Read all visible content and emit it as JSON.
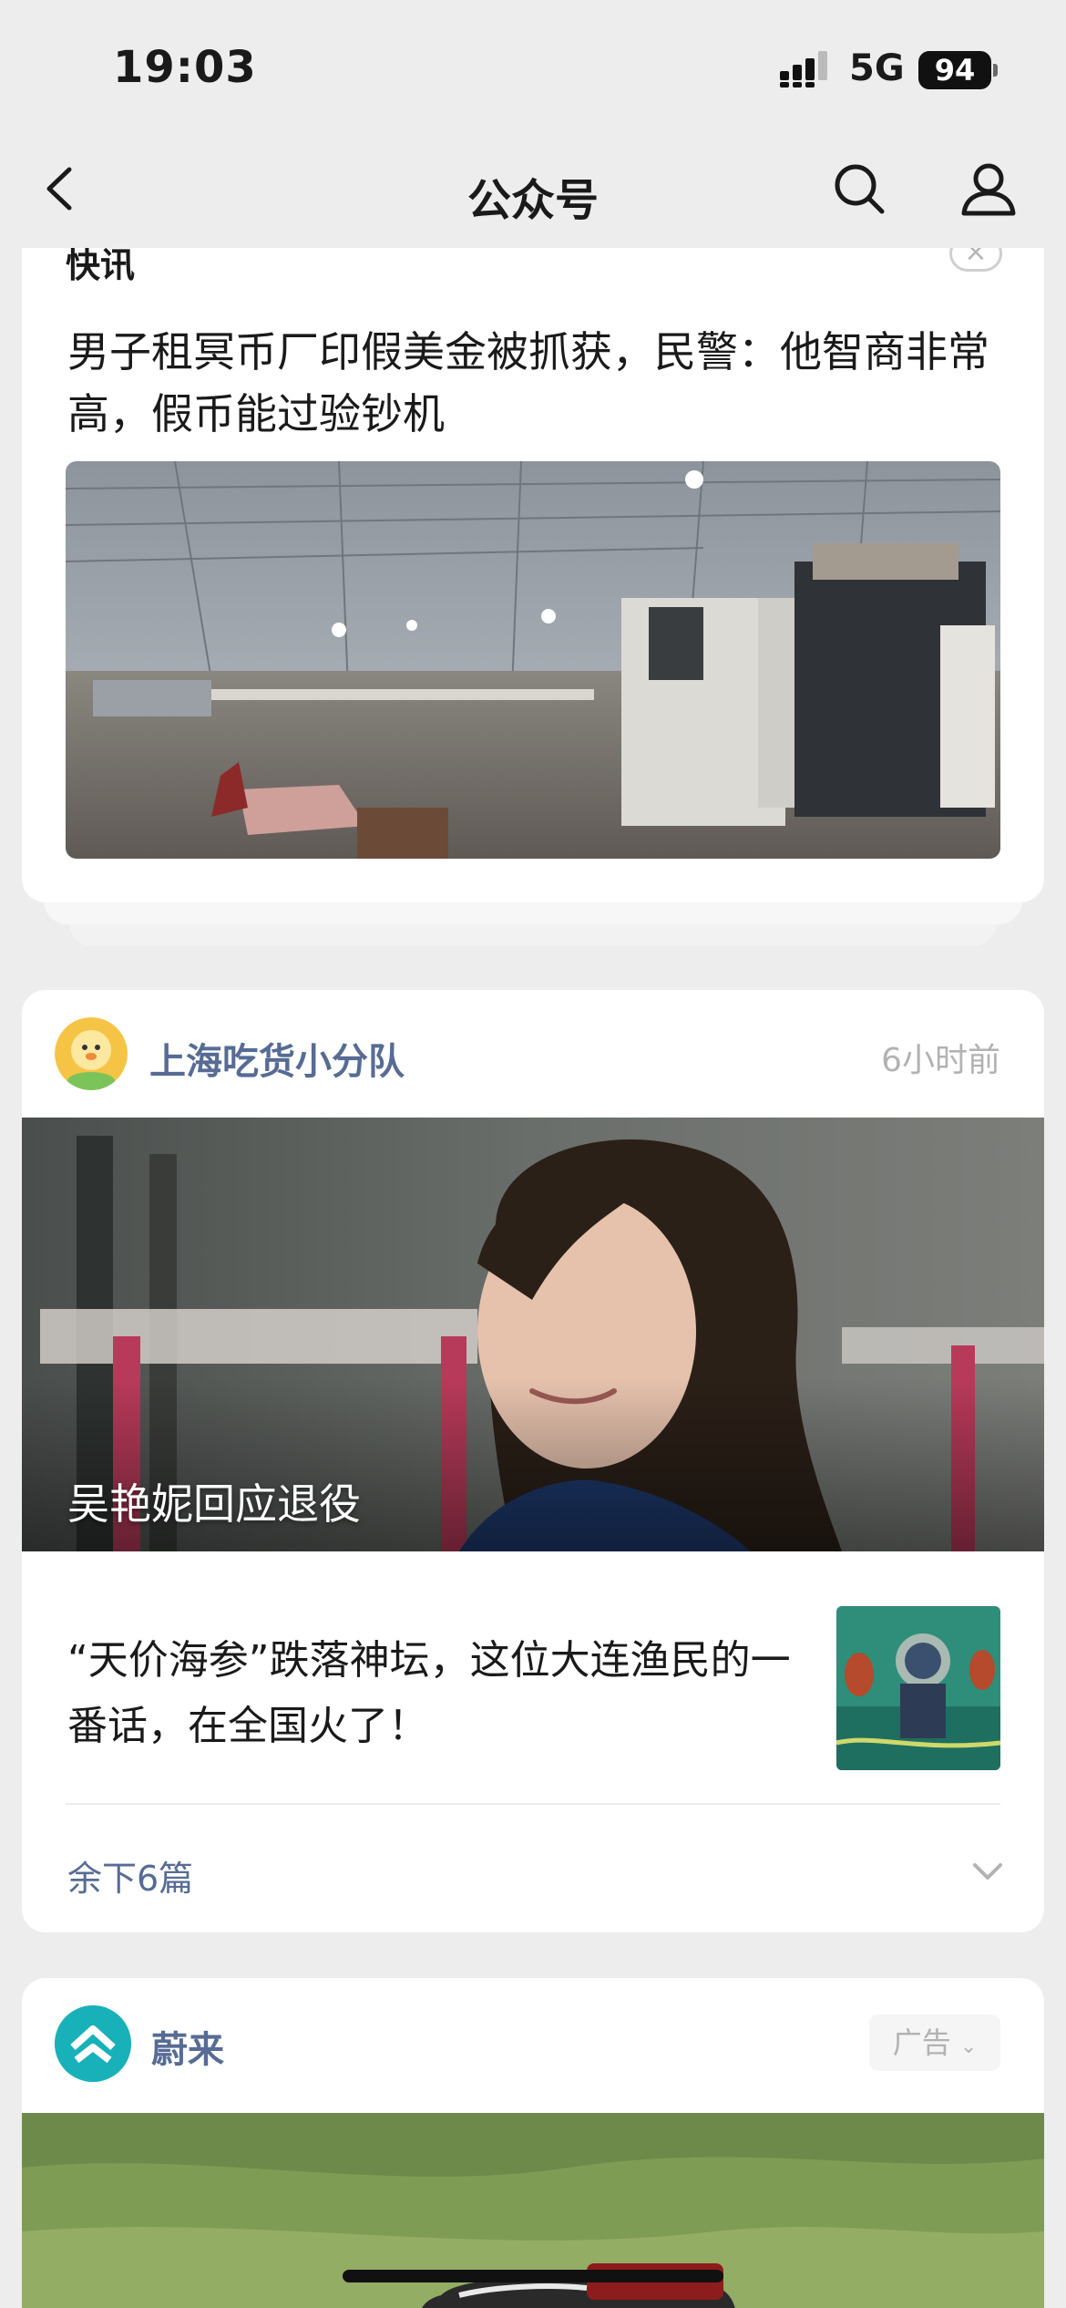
{
  "status_bar": {
    "time": "19:03",
    "network": "5G",
    "battery": "94"
  },
  "nav": {
    "title": "公众号",
    "icons": [
      "back-icon",
      "search-icon",
      "profile-icon"
    ]
  },
  "card1": {
    "section_label": "快讯",
    "close_symbol": "×",
    "headline": "男子租冥币厂印假美金被抓获，民警：他智商非常高，假币能过验钞机"
  },
  "card2": {
    "account_name": "上海吃货小分队",
    "time_ago": "6小时前",
    "hero_title": "吴艳妮回应退役",
    "sub_article_title": "“天价海参”跌落神坛，这位大连渔民的一番话，在全国火了！",
    "more_label": "余下6篇"
  },
  "card3": {
    "account_name": "蔚来",
    "ad_label": "广告"
  },
  "colors": {
    "link": "#576b95",
    "muted": "#b2b2b2",
    "background": "#ededed",
    "nio_teal": "#19b1b9"
  }
}
